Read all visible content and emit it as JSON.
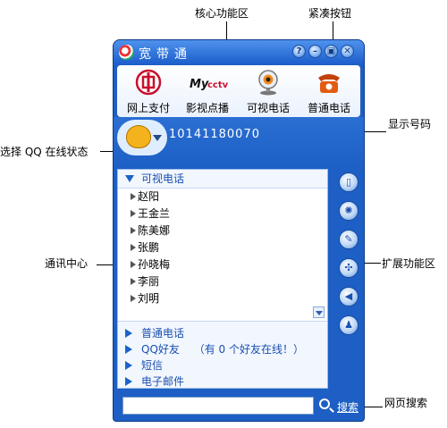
{
  "annotations": {
    "core_functions": "核心功能区",
    "compact_button": "紧凑按钮",
    "show_number": "显示号码",
    "select_qq_status": "选择 QQ 在线状态",
    "contact_center": "通讯中心",
    "extension_area": "扩展功能区",
    "web_search": "网页搜索"
  },
  "app": {
    "title": "宽带通",
    "title_buttons": [
      "?",
      "–",
      "▣",
      "✕"
    ]
  },
  "toolbar": {
    "items": [
      {
        "label": "网上支付",
        "icon": "bank-payment-icon"
      },
      {
        "label": "影视点播",
        "icon": "mycctv-video-icon"
      },
      {
        "label": "可视电话",
        "icon": "webcam-icon"
      },
      {
        "label": "普通电话",
        "icon": "telephone-icon"
      }
    ]
  },
  "profile": {
    "number": "10141180070"
  },
  "sections": {
    "video_phone": "可视电话",
    "normal_phone": "普通电话",
    "qq_friends": "QQ好友",
    "qq_note": "（有 0 个好友在线！）",
    "sms": "短信",
    "email": "电子邮件"
  },
  "contacts": [
    "赵阳",
    "王金兰",
    "陈美娜",
    "张鹏",
    "孙晓梅",
    "李丽",
    "刘明"
  ],
  "side_buttons": [
    "book-icon",
    "sun-settings-icon",
    "wrench-icon",
    "network-icon",
    "volume-icon",
    "users-icon"
  ],
  "search": {
    "placeholder": "",
    "button_label": "搜索"
  },
  "colors": {
    "window_blue": "#1d5fc4",
    "section_text": "#1a4fb0"
  }
}
